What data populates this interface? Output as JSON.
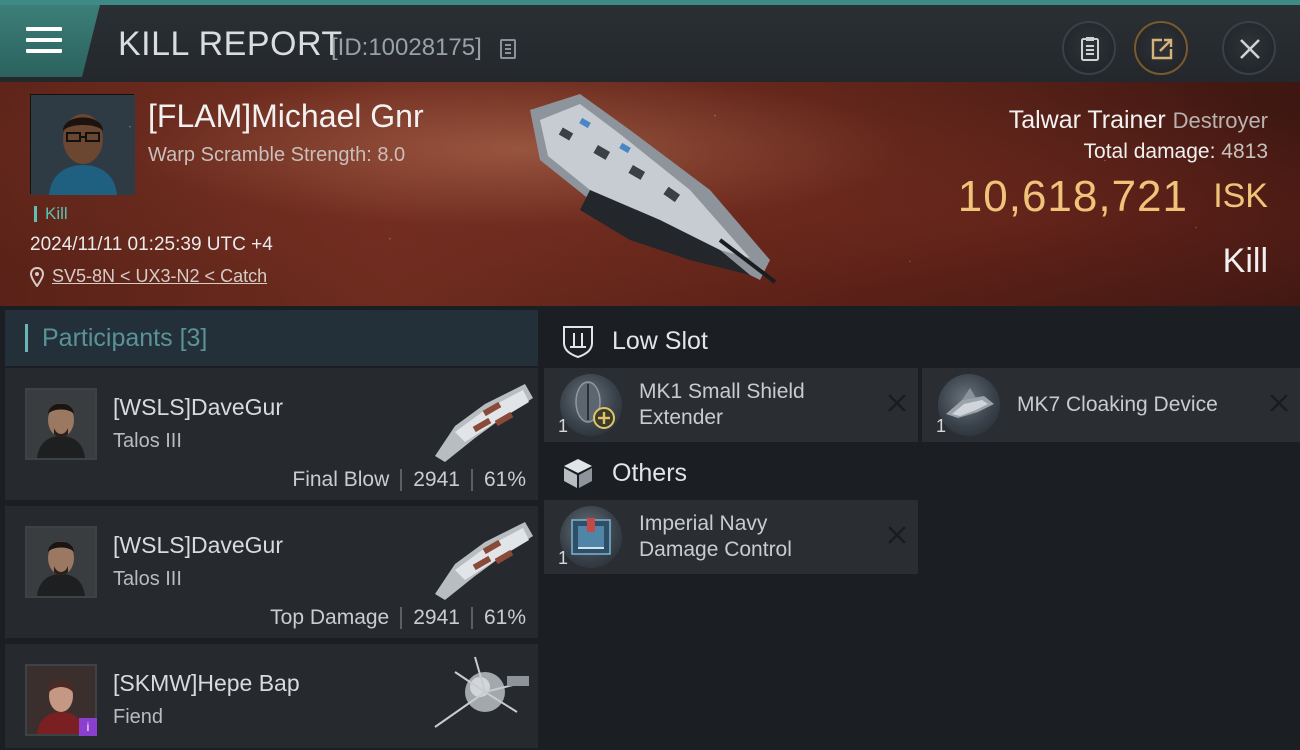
{
  "header": {
    "title": "KILL REPORT",
    "report_id": "[ID:10028175]"
  },
  "victim": {
    "name": "[FLAM]Michael Gnr",
    "warp_scramble": "Warp Scramble Strength: 8.0",
    "tag": "Kill",
    "timestamp": "2024/11/11 01:25:39 UTC +4",
    "location": "SV5-8N < UX3-N2 < Catch",
    "ship_name": "Talwar Trainer",
    "ship_class": "Destroyer",
    "total_damage_label": "Total damage:",
    "total_damage": "4813",
    "isk_value": "10,618,721",
    "isk_unit": "ISK",
    "result": "Kill"
  },
  "participants": {
    "title": "Participants",
    "count": "[3]",
    "items": [
      {
        "name": "[WSLS]DaveGur",
        "ship": "Talos III",
        "role": "Final Blow",
        "damage": "2941",
        "percent": "61%"
      },
      {
        "name": "[WSLS]DaveGur",
        "ship": "Talos III",
        "role": "Top Damage",
        "damage": "2941",
        "percent": "61%"
      },
      {
        "name": "[SKMW]Hepe Bap",
        "ship": "Fiend",
        "role": "",
        "damage": "",
        "percent": ""
      }
    ]
  },
  "fitting": {
    "low_slot": {
      "label": "Low Slot",
      "modules": [
        {
          "name_line1": "MK1 Small Shield",
          "name_line2": "Extender",
          "qty": "1"
        },
        {
          "name_line1": "MK7 Cloaking Device",
          "name_line2": "",
          "qty": "1"
        }
      ]
    },
    "others": {
      "label": "Others",
      "modules": [
        {
          "name_line1": "Imperial Navy",
          "name_line2": "Damage Control",
          "qty": "1"
        }
      ]
    }
  },
  "colors": {
    "accent_teal": "#5fc0b4",
    "isk_gold": "#f0c37a",
    "hero_red": "#6e2c1f"
  }
}
